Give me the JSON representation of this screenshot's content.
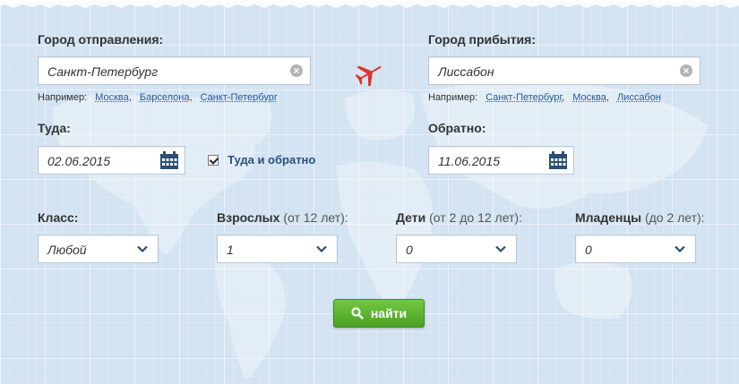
{
  "departure": {
    "label": "Город отправления:",
    "value": "Санкт-Петербург",
    "examples_label": "Например:",
    "examples": [
      "Москва",
      "Барселона",
      "Санкт-Петербург"
    ]
  },
  "arrival": {
    "label": "Город прибытия:",
    "value": "Лиссабон",
    "examples_label": "Например:",
    "examples": [
      "Санкт-Петербург",
      "Москва",
      "Лиссабон"
    ]
  },
  "outbound": {
    "label": "Туда:",
    "value": "02.06.2015"
  },
  "return_trip": {
    "label": "Обратно:",
    "value": "11.06.2015"
  },
  "round_trip": {
    "label": "Туда и обратно",
    "checked": true
  },
  "class_field": {
    "label": "Класс:",
    "value": "Любой"
  },
  "adults": {
    "label": "Взрослых",
    "hint": "(от 12 лет):",
    "value": "1"
  },
  "children": {
    "label": "Дети",
    "hint": "(от 2 до 12 лет):",
    "value": "0"
  },
  "infants": {
    "label": "Младенцы",
    "hint": "(до 2 лет):",
    "value": "0"
  },
  "search_button": {
    "label": "найти"
  },
  "icons": {
    "plane": "airplane-icon",
    "calendar": "calendar-icon",
    "clear": "clear-icon",
    "chevron": "chevron-down-icon",
    "search": "search-icon"
  },
  "colors": {
    "accent_green": "#5cb82f",
    "link_blue": "#1d5aa8",
    "plane_red": "#e0342a",
    "calendar_navy": "#2b4f73",
    "background": "#d3e3f2"
  }
}
